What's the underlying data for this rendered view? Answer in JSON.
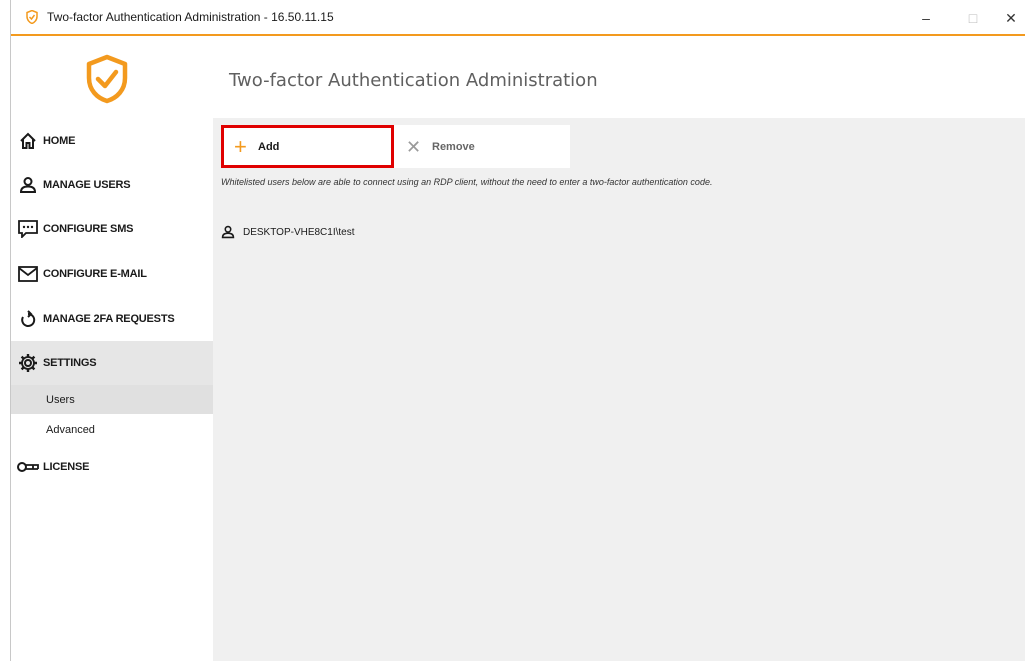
{
  "window": {
    "title": "Two-factor Authentication Administration - 16.50.11.15",
    "controls": {
      "minimize": "–",
      "maximize": "□",
      "close": "✕"
    },
    "accent_color": "#f39a1e"
  },
  "sidebar": {
    "logo_icon": "shield-check-icon",
    "items": [
      {
        "label": "HOME",
        "icon": "home-icon"
      },
      {
        "label": "MANAGE USERS",
        "icon": "user-icon"
      },
      {
        "label": "CONFIGURE SMS",
        "icon": "message-icon"
      },
      {
        "label": "CONFIGURE E-MAIL",
        "icon": "mail-icon"
      },
      {
        "label": "MANAGE 2FA REQUESTS",
        "icon": "refresh-icon"
      },
      {
        "label": "SETTINGS",
        "icon": "gear-icon",
        "active": true
      },
      {
        "label": "LICENSE",
        "icon": "key-icon"
      }
    ],
    "settings_sub": [
      {
        "label": "Users",
        "active": true
      },
      {
        "label": "Advanced"
      }
    ]
  },
  "main": {
    "title": "Two-factor Authentication Administration",
    "toolbar": {
      "add_label": "Add",
      "add_icon": "plus-icon",
      "remove_label": "Remove",
      "remove_icon": "x-icon",
      "highlight_color": "#e00000"
    },
    "info": "Whitelisted users below are able to connect using an RDP client, without the need to enter a two-factor authentication code.",
    "users": [
      {
        "name": "DESKTOP-VHE8C1I\\test",
        "icon": "user-icon"
      }
    ]
  }
}
